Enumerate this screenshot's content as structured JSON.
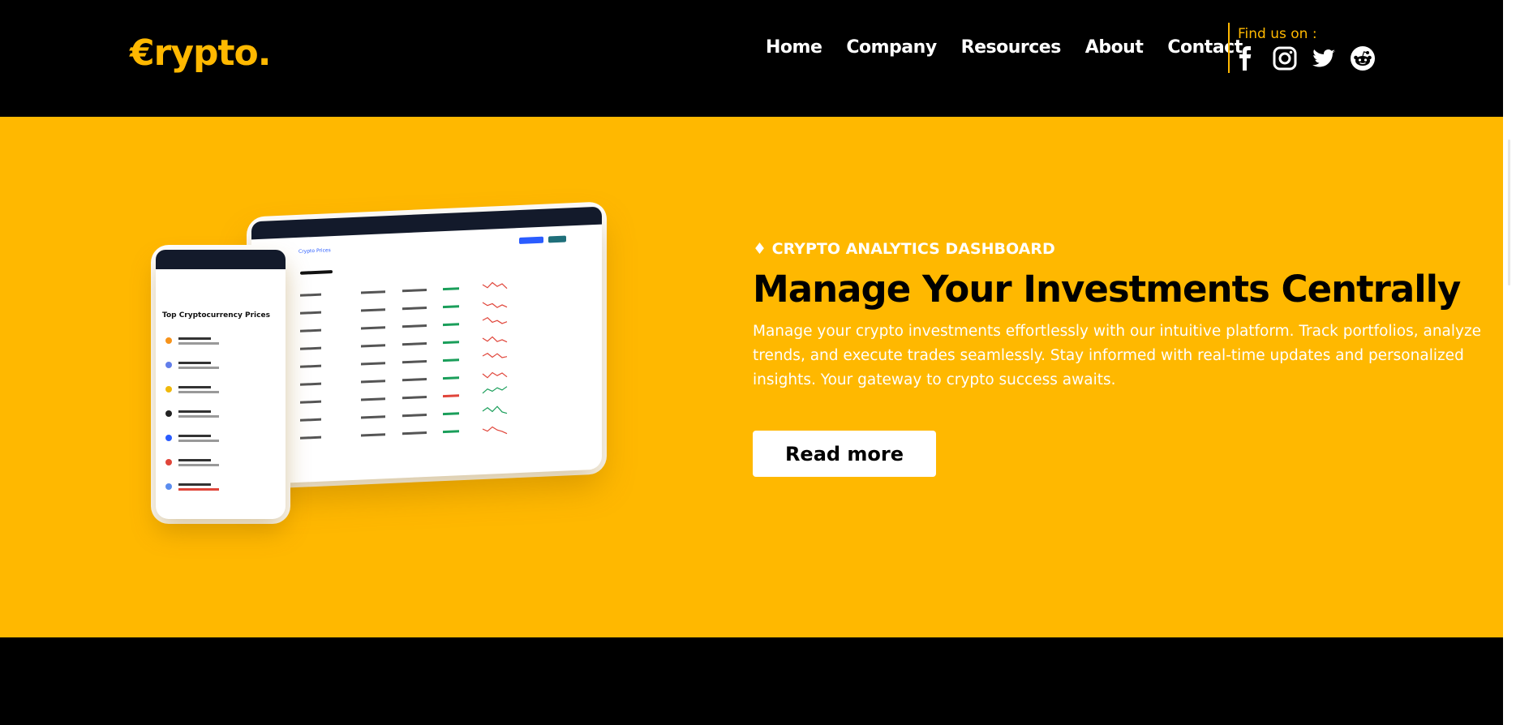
{
  "brand": {
    "logo": "€rypto."
  },
  "nav": {
    "items": [
      "Home",
      "Company",
      "Resources",
      "About",
      "Contact"
    ]
  },
  "social": {
    "label": "Find us on :",
    "icons": [
      "facebook-icon",
      "instagram-icon",
      "twitter-icon",
      "reddit-icon"
    ]
  },
  "hero": {
    "eyebrow": "♦ CRYPTO ANALYTICS DASHBOARD",
    "title": "Manage Your Investments Centrally",
    "description": "Manage your crypto investments effortlessly with our intuitive platform. Track portfolios, analyze trends, and execute trades seamlessly. Stay informed with real-time updates and personalized insights. Your gateway to crypto success awaits.",
    "cta": "Read more"
  },
  "mockup": {
    "tablet_heading": "Crypto Prices",
    "phone_heading": "Top Cryptocurrency Prices"
  },
  "colors": {
    "accent": "#ffb800",
    "dark": "#000000",
    "light": "#ffffff"
  }
}
